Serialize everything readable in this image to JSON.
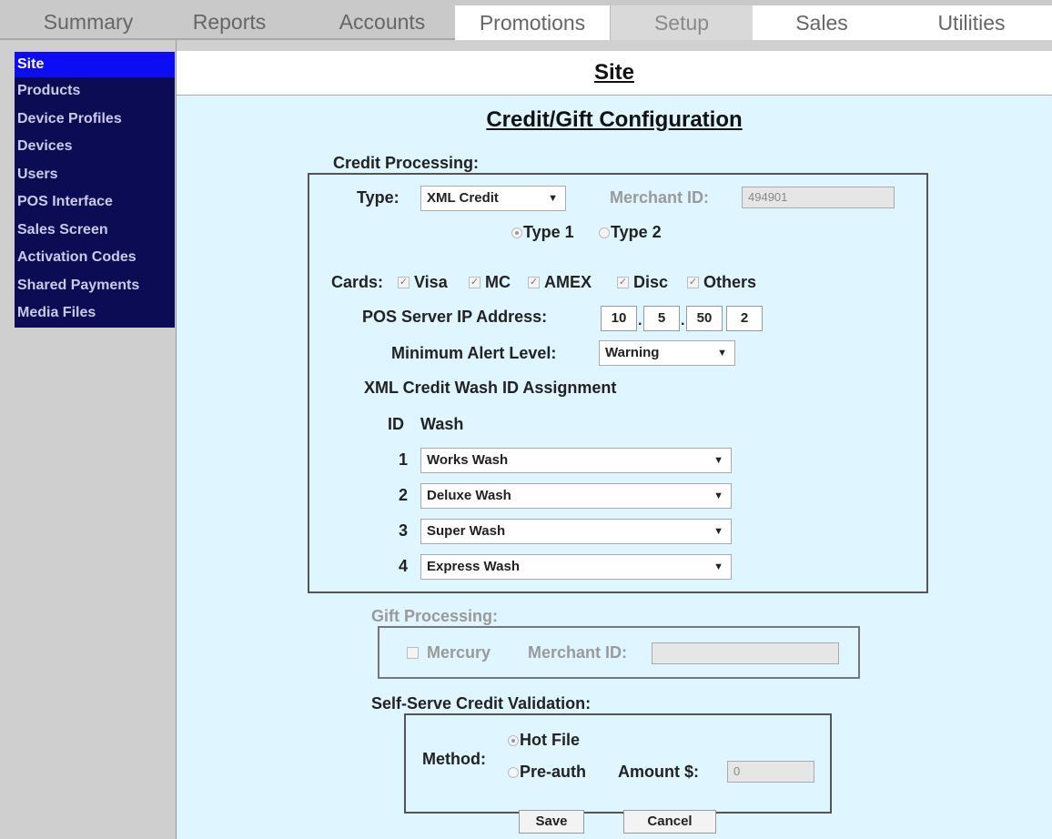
{
  "tabs": [
    "Summary",
    "Reports",
    "Accounts",
    "Promotions",
    "Setup",
    "Sales",
    "Utilities"
  ],
  "sidebar": {
    "items": [
      "Site",
      "Products",
      "Device Profiles",
      "Devices",
      "Users",
      "POS Interface",
      "Sales Screen",
      "Activation Codes",
      "Shared Payments",
      "Media Files"
    ]
  },
  "page": {
    "title": "Site",
    "heading": "Credit/Gift Configuration"
  },
  "credit": {
    "section_label": "Credit Processing:",
    "type_label": "Type:",
    "type_value": "XML Credit",
    "merchant_label": "Merchant ID:",
    "merchant_value": "494901",
    "type1_label": "Type 1",
    "type2_label": "Type 2",
    "type_selected": "Type 1",
    "cards_label": "Cards:",
    "cards": [
      {
        "label": "Visa",
        "checked": true
      },
      {
        "label": "MC",
        "checked": true
      },
      {
        "label": "AMEX",
        "checked": true
      },
      {
        "label": "Disc",
        "checked": true
      },
      {
        "label": "Others",
        "checked": true
      }
    ],
    "ip_label": "POS Server IP Address:",
    "ip": [
      "10",
      "5",
      "50",
      "2"
    ],
    "alert_label": "Minimum Alert Level:",
    "alert_value": "Warning",
    "wash_heading": "XML Credit Wash ID Assignment",
    "id_header": "ID",
    "wash_header": "Wash",
    "washes": [
      {
        "id": "1",
        "wash": "Works Wash"
      },
      {
        "id": "2",
        "wash": "Deluxe Wash"
      },
      {
        "id": "3",
        "wash": "Super Wash"
      },
      {
        "id": "4",
        "wash": "Express Wash"
      }
    ]
  },
  "gift": {
    "section_label": "Gift Processing:",
    "mercury_label": "Mercury",
    "merchant_label": "Merchant ID:",
    "merchant_value": ""
  },
  "selfserve": {
    "section_label": "Self-Serve Credit Validation:",
    "method_label": "Method:",
    "hotfile_label": "Hot File",
    "preauth_label": "Pre-auth",
    "amount_label": "Amount $:",
    "amount_value": "0",
    "selected": "Hot File"
  },
  "buttons": {
    "save": "Save",
    "cancel": "Cancel"
  },
  "icons": {
    "dropdown": "chevron-down-icon",
    "check": "check-icon"
  },
  "colors": {
    "nav_bg": "#0c0c55",
    "nav_active": "#0d0df5",
    "content_bg": "#dff5ff"
  }
}
